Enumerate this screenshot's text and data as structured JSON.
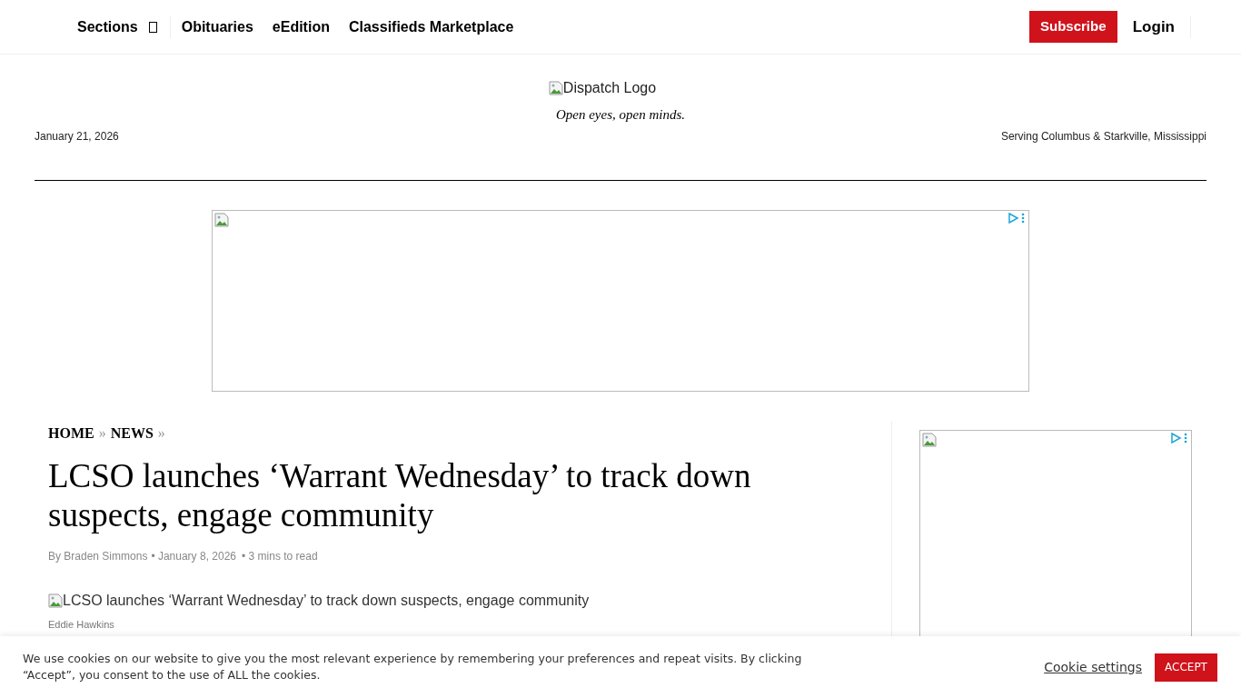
{
  "nav": {
    "sections_label": "Sections",
    "links": [
      "Obituaries",
      "eEdition",
      "Classifieds Marketplace"
    ],
    "subscribe": "Subscribe",
    "login": "Login"
  },
  "masthead": {
    "logo_alt": "Dispatch Logo",
    "tagline": "Open eyes, open minds.",
    "date": "January 21, 2026",
    "serving": "Serving Columbus & Starkville, Mississippi"
  },
  "breadcrumb": [
    {
      "label": "HOME"
    },
    {
      "label": "NEWS"
    }
  ],
  "breadcrumb_separator": "»",
  "article": {
    "title": "LCSO launches ‘Warrant Wednesday’ to track down suspects, engage community",
    "byline": "By Braden Simmons",
    "date": "• January 8, 2026",
    "read_time": "• 3 mins to read",
    "image_alt": "LCSO launches ‘Warrant Wednesday’ to track down suspects, engage community",
    "image_credit": "Eddie Hawkins"
  },
  "cookie_bar": {
    "text": "We use cookies on our website to give you the most relevant experience by remembering your preferences and repeat visits. By clicking “Accept”, you consent to the use of ALL the cookies.",
    "settings": "Cookie settings",
    "accept": "ACCEPT"
  }
}
